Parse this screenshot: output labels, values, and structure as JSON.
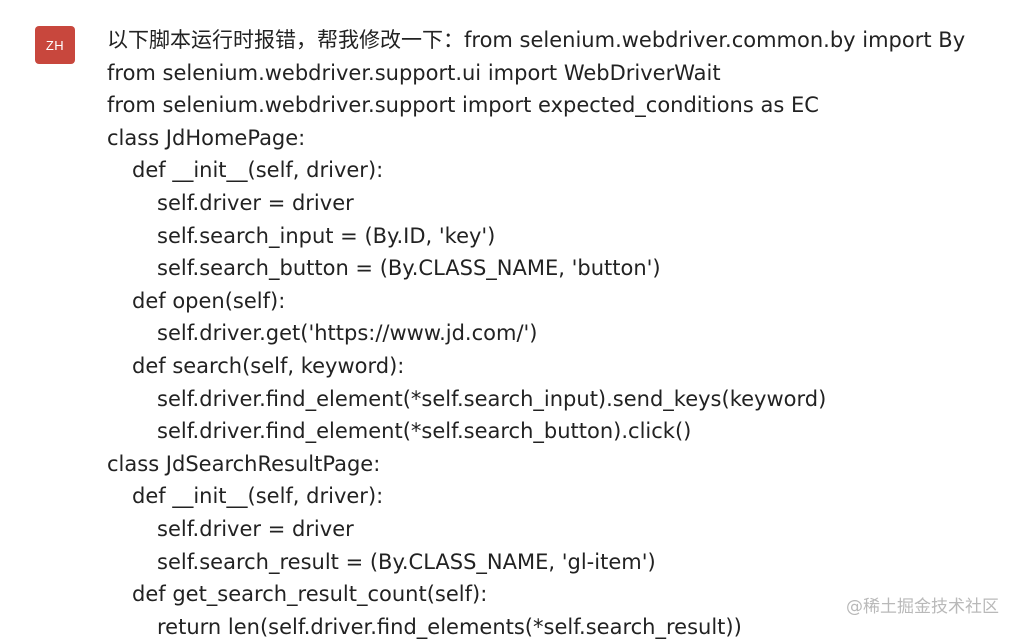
{
  "message": {
    "avatar_text": "ZH",
    "lines": [
      {
        "indent": 0,
        "text": "以下脚本运行时报错，帮我修改一下：from selenium.webdriver.common.by import By"
      },
      {
        "indent": 0,
        "text": "from selenium.webdriver.support.ui import WebDriverWait"
      },
      {
        "indent": 0,
        "text": "from selenium.webdriver.support import expected_conditions as EC"
      },
      {
        "indent": 0,
        "text": "class JdHomePage:"
      },
      {
        "indent": 1,
        "text": "def __init__(self, driver):"
      },
      {
        "indent": 2,
        "text": "self.driver = driver"
      },
      {
        "indent": 2,
        "text": "self.search_input = (By.ID, 'key')"
      },
      {
        "indent": 2,
        "text": "self.search_button = (By.CLASS_NAME, 'button')"
      },
      {
        "indent": 1,
        "text": "def open(self):"
      },
      {
        "indent": 2,
        "text": "self.driver.get('https://www.jd.com/')"
      },
      {
        "indent": 1,
        "text": "def search(self, keyword):"
      },
      {
        "indent": 2,
        "text": "self.driver.find_element(*self.search_input).send_keys(keyword)"
      },
      {
        "indent": 2,
        "text": "self.driver.find_element(*self.search_button).click()"
      },
      {
        "indent": 0,
        "text": "class JdSearchResultPage:"
      },
      {
        "indent": 1,
        "text": "def __init__(self, driver):"
      },
      {
        "indent": 2,
        "text": "self.driver = driver"
      },
      {
        "indent": 2,
        "text": "self.search_result = (By.CLASS_NAME, 'gl-item')"
      },
      {
        "indent": 1,
        "text": "def get_search_result_count(self):"
      },
      {
        "indent": 2,
        "text": "return len(self.driver.find_elements(*self.search_result))"
      }
    ]
  },
  "watermark": "@稀土掘金技术社区",
  "colors": {
    "avatar_bg": "#c8473d",
    "text": "#222222",
    "watermark": "#b9b9b9"
  }
}
